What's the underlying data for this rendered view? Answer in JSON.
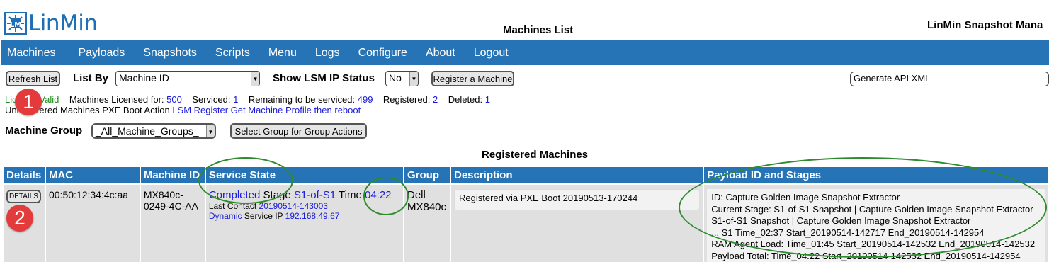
{
  "header": {
    "logo_text": "LinMin",
    "page_title": "Machines List",
    "brand_title": "LinMin Snapshot Mana"
  },
  "nav": [
    "Machines",
    "Payloads",
    "Snapshots",
    "Scripts",
    "Menu",
    "Logs",
    "Configure",
    "About",
    "Logout"
  ],
  "toolbar": {
    "refresh_label": "Refresh List",
    "list_by_label": "List By",
    "list_by_value": "Machine ID",
    "show_status_label": "Show LSM IP Status",
    "show_status_value": "No",
    "register_label": "Register a Machine",
    "api_value": "Generate API XML"
  },
  "license": {
    "valid_text": "License Valid",
    "licensed_label": "Machines Licensed for:",
    "licensed_value": "500",
    "serviced_label": "Serviced:",
    "serviced_value": "1",
    "remaining_label": "Remaining to be serviced:",
    "remaining_value": "499",
    "registered_label": "Registered:",
    "registered_value": "2",
    "deleted_label": "Deleted:",
    "deleted_value": "1",
    "pxe_prefix": "Unregistered Machines PXE Boot Action",
    "pxe_link": "LSM Register Get Machine Profile then reboot"
  },
  "group": {
    "label": "Machine Group",
    "value": "_All_Machine_Groups_",
    "button": "Select Group for Group Actions"
  },
  "section_title": "Registered Machines",
  "table": {
    "headers": [
      "Details",
      "MAC",
      "Machine ID",
      "Service State",
      "Group",
      "Description",
      "Payload ID and Stages"
    ],
    "row": {
      "details_button": "DETAILS",
      "mac": "00:50:12:34:4c:aa",
      "machine_id": "MX840c-0249-4C-AA",
      "state_completed": "Completed",
      "state_stage_label": "Stage",
      "state_stage_value": "S1-of-S1",
      "state_time_label": "Time",
      "state_time_value": "04:22",
      "last_contact_label": "Last Contact",
      "last_contact_value": "20190514-143003",
      "ip_mode": "Dynamic",
      "ip_label": "Service IP",
      "ip_value": "192.168.49.67",
      "group": "Dell MX840c",
      "description": "Registered via PXE Boot 20190513-170244",
      "payload_lines": [
        "ID: Capture Golden Image Snapshot Extractor",
        "Current Stage: S1-of-S1 Snapshot | Capture Golden Image Snapshot Extractor",
        "S1-of-S1 Snapshot | Capture Golden Image Snapshot Extractor",
        "... S1  Time_02:37 Start_20190514-142717 End_20190514-142954",
        "RAM Agent Load: Time_01:45 Start_20190514-142532 End_20190514-142532",
        "Payload Total: Time_04:22 Start_20190514-142532 End_20190514-142954"
      ]
    }
  },
  "annotations": {
    "badge_1": "1",
    "badge_2": "2"
  },
  "colors": {
    "nav_bg": "#2673b5",
    "link": "#1a1adc",
    "valid": "#1e8a1e",
    "badge": "#e33b3b",
    "oval": "#2e8b2e"
  }
}
